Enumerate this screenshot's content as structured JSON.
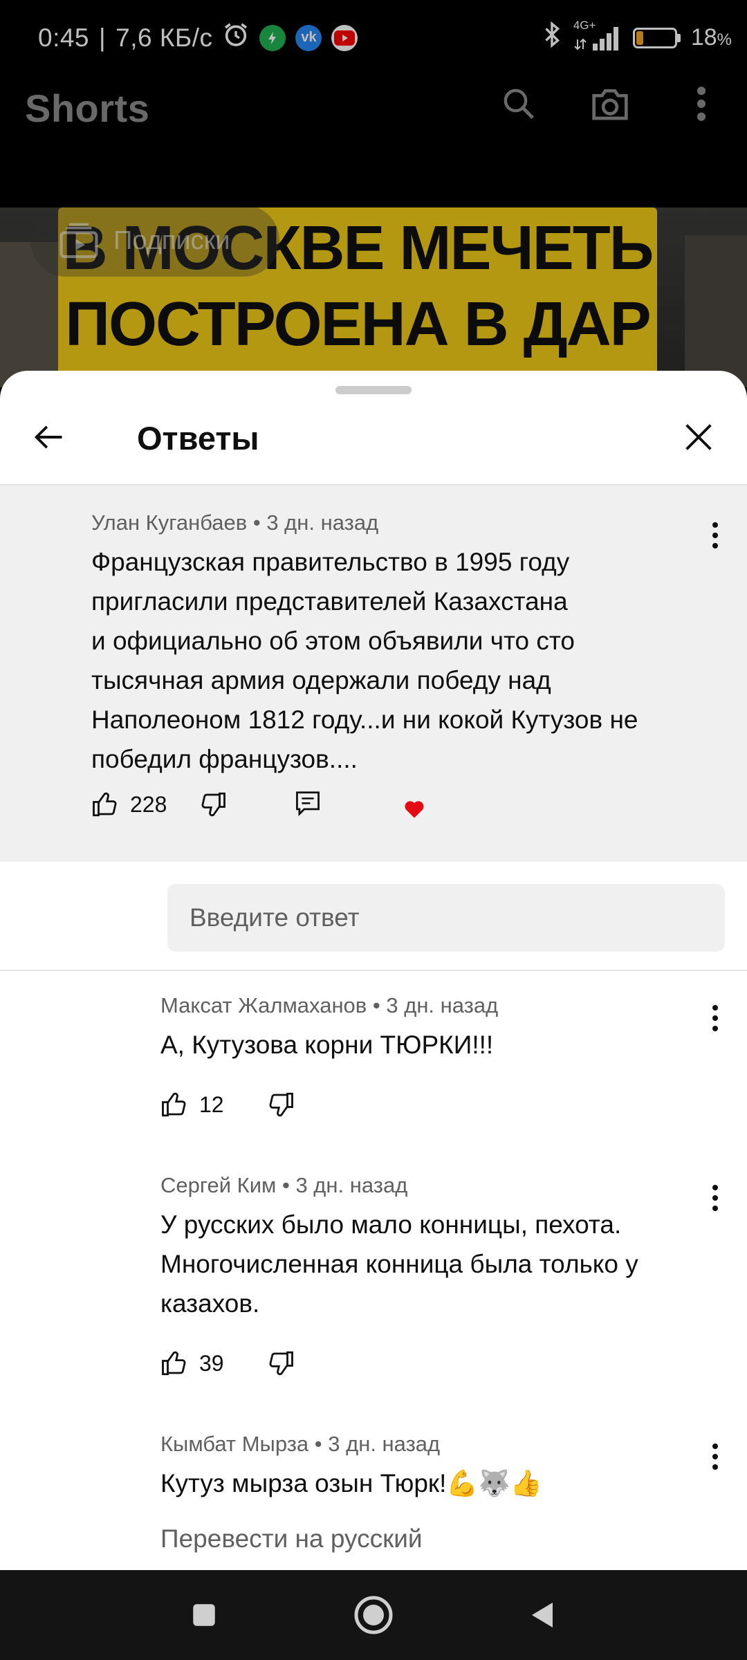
{
  "status_bar": {
    "time": "0:45",
    "separator": "|",
    "net_speed": "7,6 КБ/с",
    "network": "4G+",
    "battery": "18",
    "battery_unit": "%",
    "battery_level": 0.18,
    "colors": {
      "battery_fill": "#f5a623"
    }
  },
  "shorts_header": {
    "title": "Shorts",
    "subscriptions_label": "Подписки",
    "icons": [
      "search-icon",
      "camera-icon",
      "more-vert-icon"
    ]
  },
  "video": {
    "banner_line1": "В МОСКВЕ МЕЧЕТЬ",
    "banner_line2": "ПОСТРОЕНА В ДАР",
    "colors": {
      "banner": "#f1cb17"
    }
  },
  "sheet": {
    "title": "Ответы",
    "parent_comment": {
      "author": "Улан Куганбаев",
      "time": "3 дн. назад",
      "text_lines": [
        "Французская правительство в 1995 году",
        "пригласили представителей Казахстана",
        "и официально об этом объявили что сто",
        "тысячная армия одержали победу над",
        "Наполеоном 1812 году...и ни кокой Кутузов не",
        "победил французов...."
      ],
      "likes": "228",
      "hearted": true
    },
    "reply_input": {
      "placeholder": "Введите ответ"
    },
    "replies": [
      {
        "author": "Максат Жалмаханов",
        "time": "3 дн. назад",
        "text_lines": [
          "А, Кутузова корни ТЮРКИ!!!"
        ],
        "likes": "12"
      },
      {
        "author": "Сергей Ким",
        "time": "3 дн. назад",
        "text_lines": [
          "У русских было мало конницы, пехота.",
          "Многочисленная конница была только у",
          "казахов."
        ],
        "likes": "39"
      },
      {
        "author": "Кымбат Мырза",
        "time": "3 дн. назад",
        "text_lines": [
          "Кутуз мырза озын Тюрк!💪🐺👍"
        ],
        "translate": "Перевести на русский"
      }
    ],
    "meta_separator": " • "
  },
  "nav_bar": {
    "buttons": [
      "recents-button",
      "home-button",
      "back-button"
    ]
  }
}
